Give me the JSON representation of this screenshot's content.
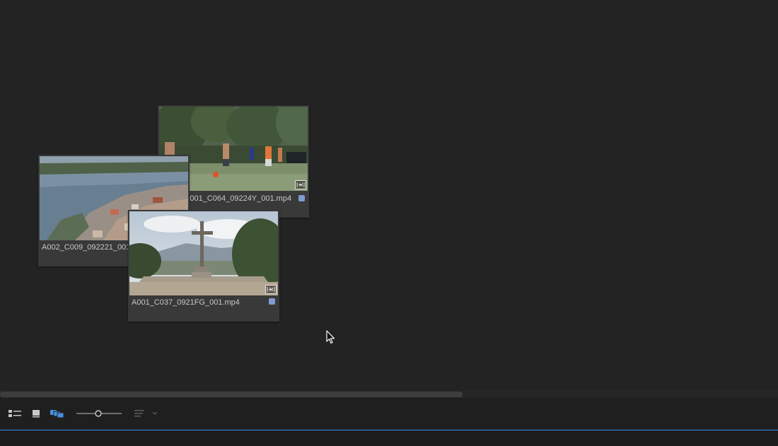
{
  "clips": [
    {
      "id": "football",
      "name": "A001_C064_09224Y_001.mp4",
      "label_color": "#7f9bd0"
    },
    {
      "id": "town",
      "name": "A002_C009_092221_001.mp4",
      "label_color": "#7f9bd0"
    },
    {
      "id": "cross",
      "name": "A001_C037_0921FG_001.mp4",
      "label_color": "#7f9bd0"
    }
  ],
  "toolbar": {
    "list_view_icon": "list-view-icon",
    "icon_view_icon": "icon-view-icon",
    "freeform_view_icon": "freeform-view-icon",
    "zoom_slider_icon": "zoom-slider",
    "sort_icon": "sort-icon",
    "active_view": "freeform"
  },
  "colors": {
    "panel_bg": "#232323",
    "card_bg": "#393939",
    "accent": "#2d8ceb",
    "label_swatch": "#7f9bd0",
    "active_icon": "#4a90e2"
  }
}
